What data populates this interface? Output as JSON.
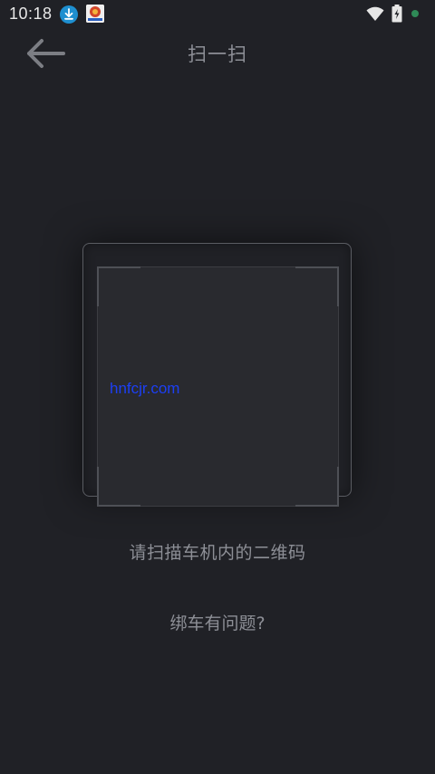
{
  "status_bar": {
    "time": "10:18",
    "icons": [
      "download-notification-icon",
      "app-notification-icon",
      "wifi-icon",
      "battery-charging-icon",
      "status-dot"
    ],
    "colors": {
      "download": "#1e8fd0",
      "dot": "#2f8a57"
    }
  },
  "header": {
    "back_icon": "arrow-left-icon",
    "title": "扫一扫"
  },
  "scanner": {
    "watermark": "hnfcjr.com",
    "hint": "请扫描车机内的二维码"
  },
  "footer": {
    "problem_link": "绑车有问题?"
  },
  "theme": {
    "background": "#202126",
    "text_muted": "#8d8f96",
    "watermark": "#1c3ff5"
  }
}
